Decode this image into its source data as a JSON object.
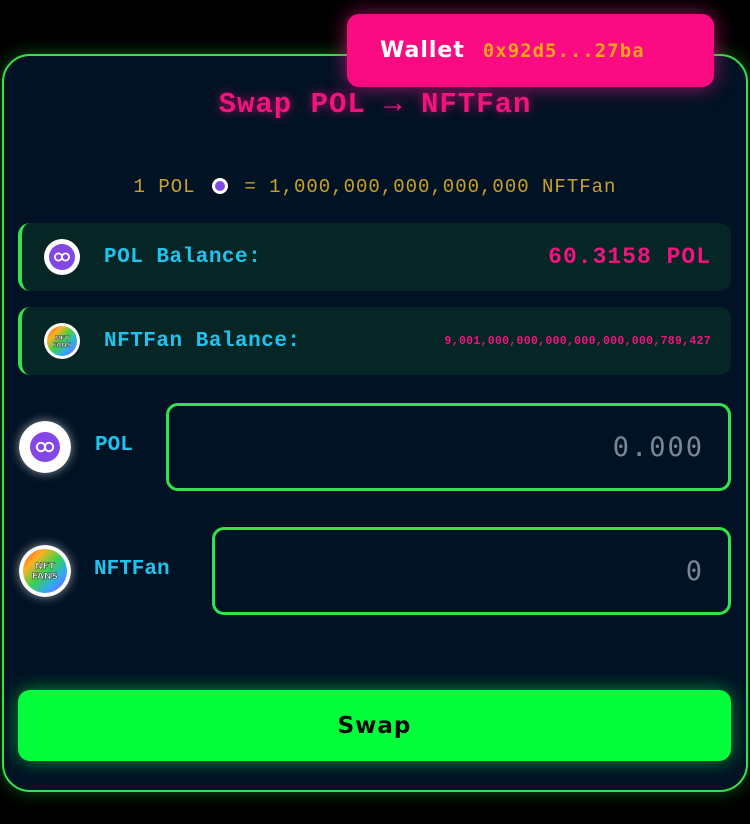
{
  "wallet": {
    "label": "Wallet",
    "address": "0x92d5...27ba"
  },
  "title": "Swap POL → NFTFan",
  "rate": {
    "left": "1 POL",
    "right": "= 1,000,000,000,000,000 NFTFan"
  },
  "balances": [
    {
      "label": "POL Balance:",
      "value": "60.3158 POL",
      "icon": "polygon-icon"
    },
    {
      "label": "NFTFan Balance:",
      "value": "9,001,000,000,000,000,000,000,789,427",
      "icon": "nftfans-icon"
    }
  ],
  "inputs": [
    {
      "token": "POL",
      "placeholder": "0.000",
      "value": "",
      "icon": "polygon-icon"
    },
    {
      "token": "NFTFan",
      "placeholder": "0",
      "value": "",
      "icon": "nftfans-icon"
    }
  ],
  "nftfans_logo_text": "NFT FANS",
  "swap_label": "Swap",
  "colors": {
    "accent_green": "#33e24c",
    "accent_pink": "#f3137f",
    "label_cyan": "#1ec3ee",
    "rate_gold": "#c9a227",
    "polygon_purple": "#8247e5"
  }
}
